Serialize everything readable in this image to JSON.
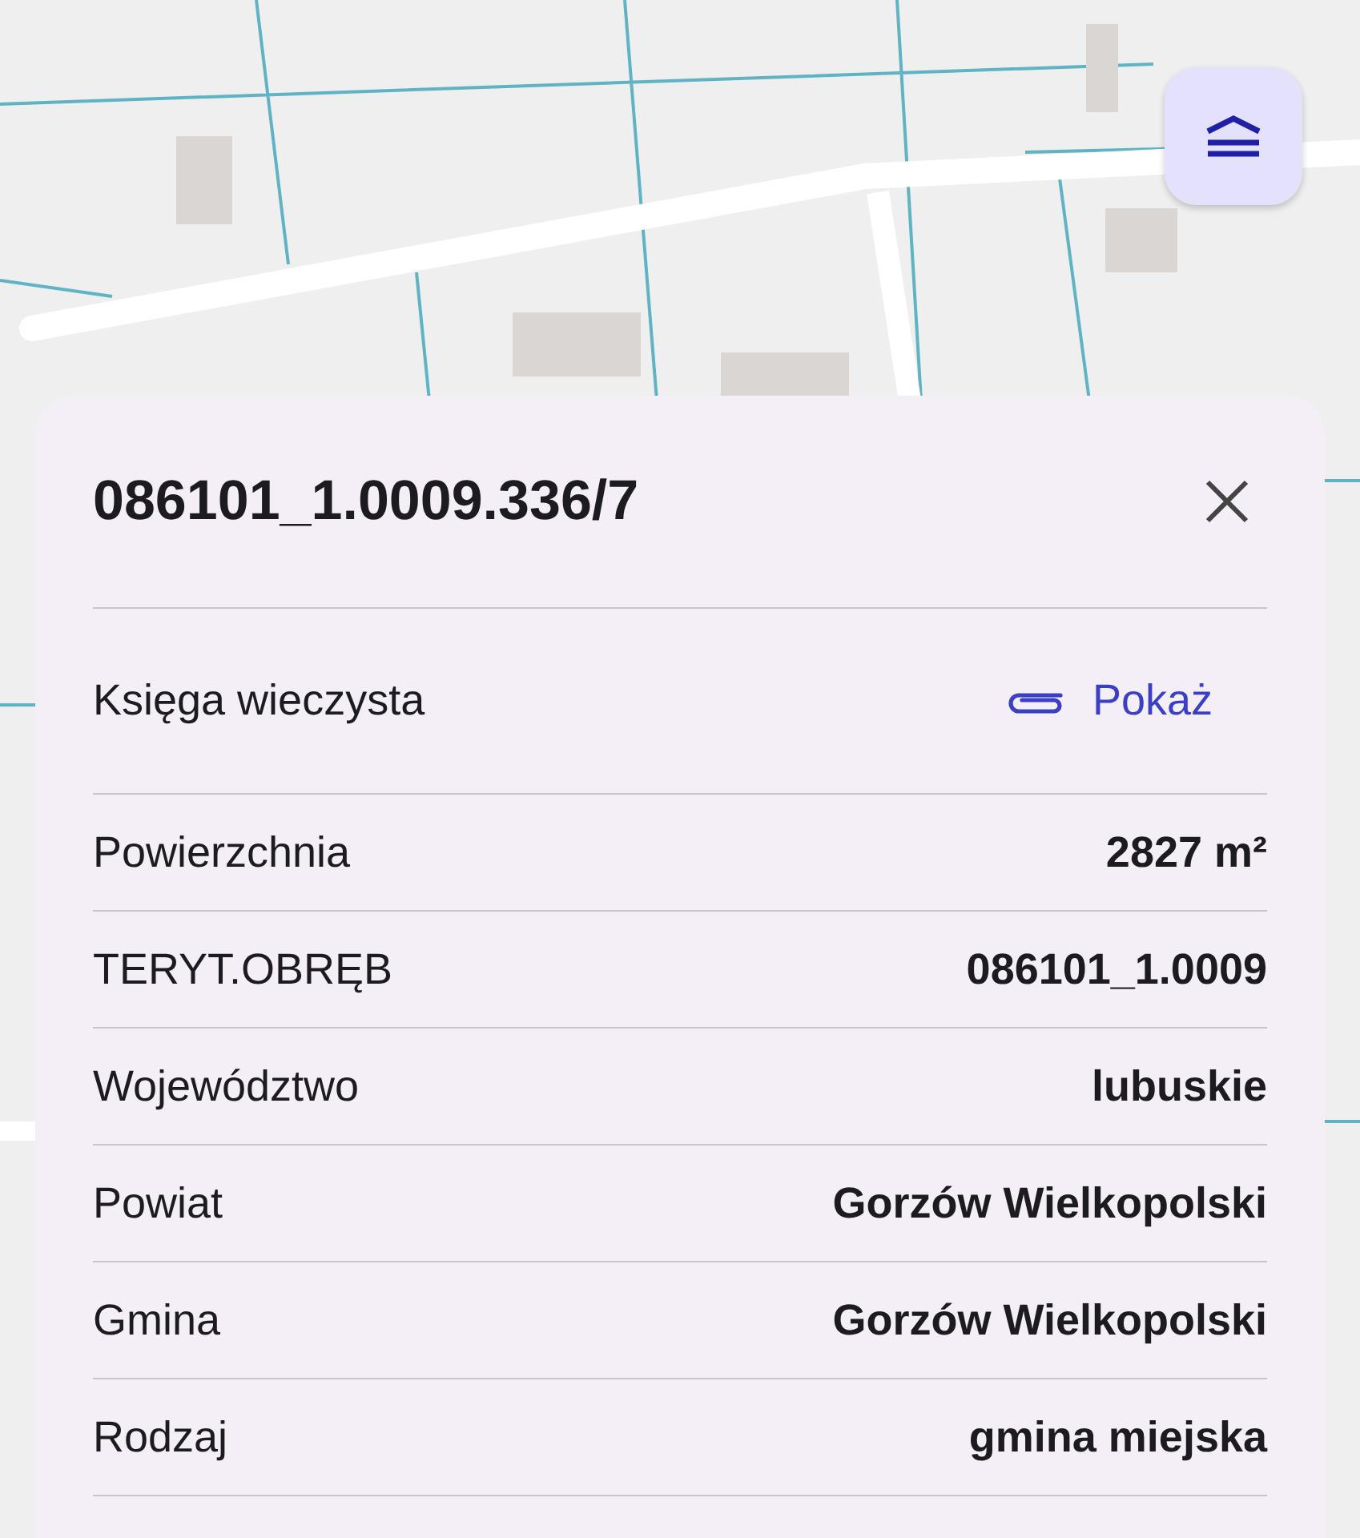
{
  "panel": {
    "title": "086101_1.0009.336/7",
    "rows": [
      {
        "kind": "link",
        "label": "Księga wieczysta",
        "value": "Pokaż"
      },
      {
        "kind": "text",
        "label": "Powierzchnia",
        "value": "2827 m²"
      },
      {
        "kind": "text",
        "label": "TERYT.OBRĘB",
        "value": "086101_1.0009"
      },
      {
        "kind": "text",
        "label": "Województwo",
        "value": "lubuskie"
      },
      {
        "kind": "text",
        "label": "Powiat",
        "value": "Gorzów Wielkopolski"
      },
      {
        "kind": "text",
        "label": "Gmina",
        "value": "Gorzów Wielkopolski"
      },
      {
        "kind": "text",
        "label": "Rodzaj",
        "value": "gmina miejska"
      }
    ]
  }
}
